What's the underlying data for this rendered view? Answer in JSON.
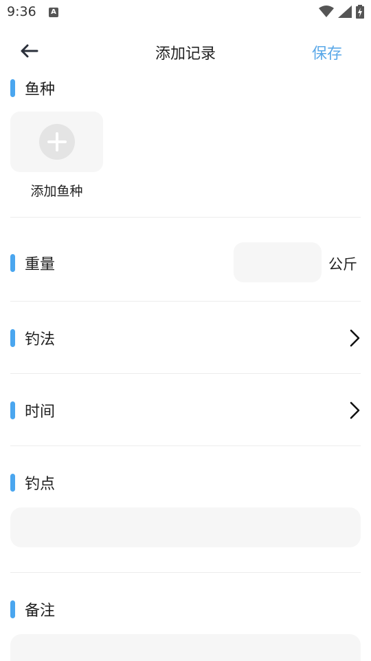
{
  "status_bar": {
    "time": "9:36",
    "notification_glyph": "A",
    "icons": [
      "wifi-icon",
      "cell-signal-icon",
      "battery-charging-icon"
    ]
  },
  "app_bar": {
    "title": "添加记录",
    "save_label": "保存",
    "back_icon": "arrow-left-icon",
    "accent_color": "#5aa8e8"
  },
  "sections": {
    "fish_species": {
      "label": "鱼种",
      "add_label": "添加鱼种",
      "add_icon": "plus-circle-icon"
    },
    "weight": {
      "label": "重量",
      "value": "",
      "placeholder": "",
      "unit": "公斤"
    },
    "method": {
      "label": "钓法",
      "value": "",
      "chevron_icon": "chevron-right-icon"
    },
    "time": {
      "label": "时间",
      "value": "",
      "chevron_icon": "chevron-right-icon"
    },
    "spot": {
      "label": "钓点",
      "value": "",
      "placeholder": ""
    },
    "notes": {
      "label": "备注",
      "value": "",
      "placeholder": ""
    }
  },
  "colors": {
    "section_accent": "#4aa6ef",
    "field_background": "#f6f6f6",
    "divider": "#ececec"
  }
}
